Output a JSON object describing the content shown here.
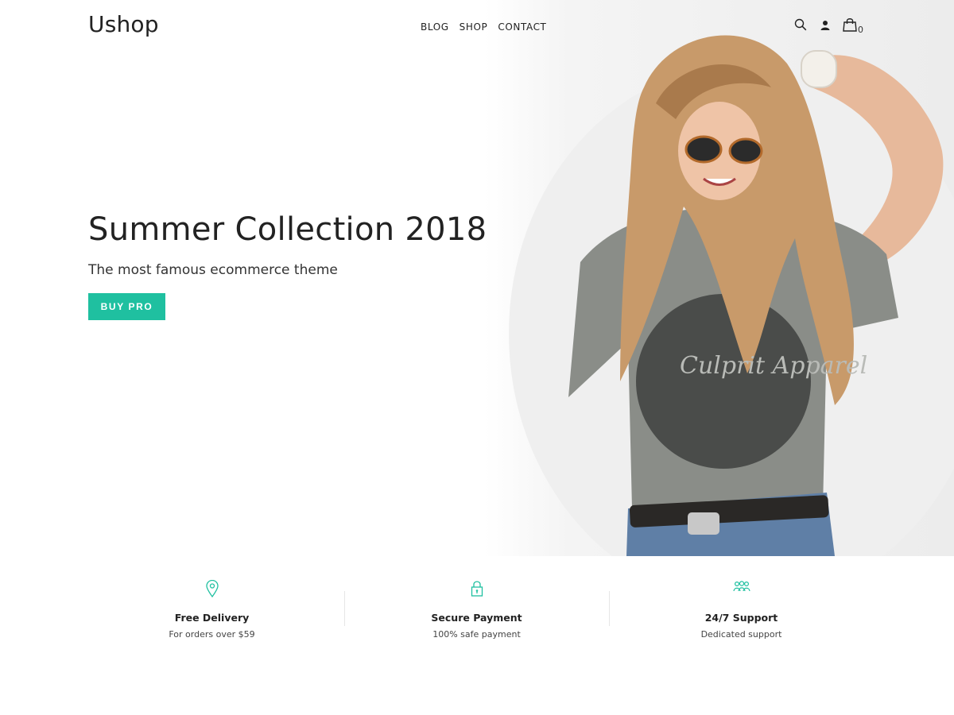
{
  "header": {
    "logo": "Ushop",
    "nav": [
      "BLOG",
      "SHOP",
      "CONTACT"
    ],
    "icons": [
      "search-icon",
      "user-icon",
      "shopping-bag-icon"
    ],
    "cart_count": "0"
  },
  "hero": {
    "title": "Summer Collection 2018",
    "subtitle": "The most famous ecommerce theme",
    "button_label": "BUY PRO",
    "image_text": "Culprit Apparel"
  },
  "features": [
    {
      "icon": "map-pin-icon",
      "title": "Free Delivery",
      "subtitle": "For orders over $59"
    },
    {
      "icon": "lock-icon",
      "title": "Secure Payment",
      "subtitle": "100% safe payment"
    },
    {
      "icon": "people-icon",
      "title": "24/7 Support",
      "subtitle": "Dedicated support"
    }
  ],
  "colors": {
    "accent": "#1fc0a0",
    "text": "#222222",
    "background": "#ffffff"
  }
}
